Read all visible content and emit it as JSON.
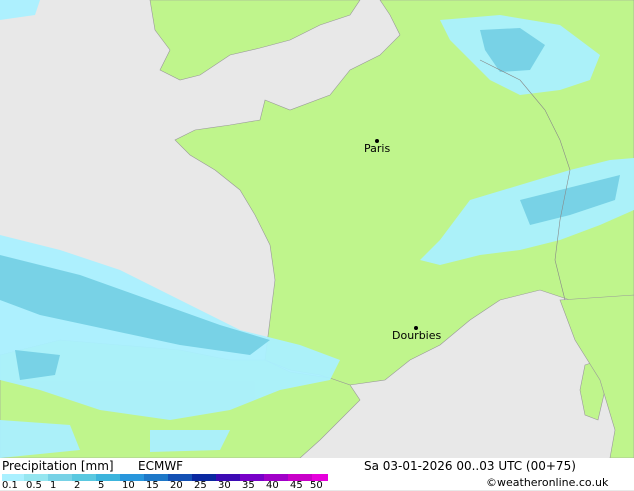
{
  "header": {
    "title": "Precipitation [mm]",
    "model": "ECMWF",
    "valid_time": "Sa 03-01-2026 00..03 UTC (00+75)",
    "credit": "©weatheronline.co.uk"
  },
  "cities": [
    {
      "name": "Paris"
    },
    {
      "name": "Dourbies"
    }
  ],
  "legend": {
    "ticks": [
      "0.1",
      "0.5",
      "1",
      "2",
      "5",
      "10",
      "15",
      "20",
      "25",
      "30",
      "35",
      "40",
      "45",
      "50"
    ],
    "colors": [
      "#aaf0ff",
      "#96e6f0",
      "#78d2e6",
      "#5ac8e0",
      "#3cb4dc",
      "#2896dc",
      "#1e78c8",
      "#1450b4",
      "#0a28a0",
      "#3c0ab4",
      "#7800c8",
      "#a000c8",
      "#c800c8",
      "#e600dc"
    ]
  },
  "map": {
    "land_color": "#bff58c",
    "sea_color": "#e8e8e8",
    "rain_light": "#aaf0ff",
    "rain_medium": "#78d2e6"
  }
}
